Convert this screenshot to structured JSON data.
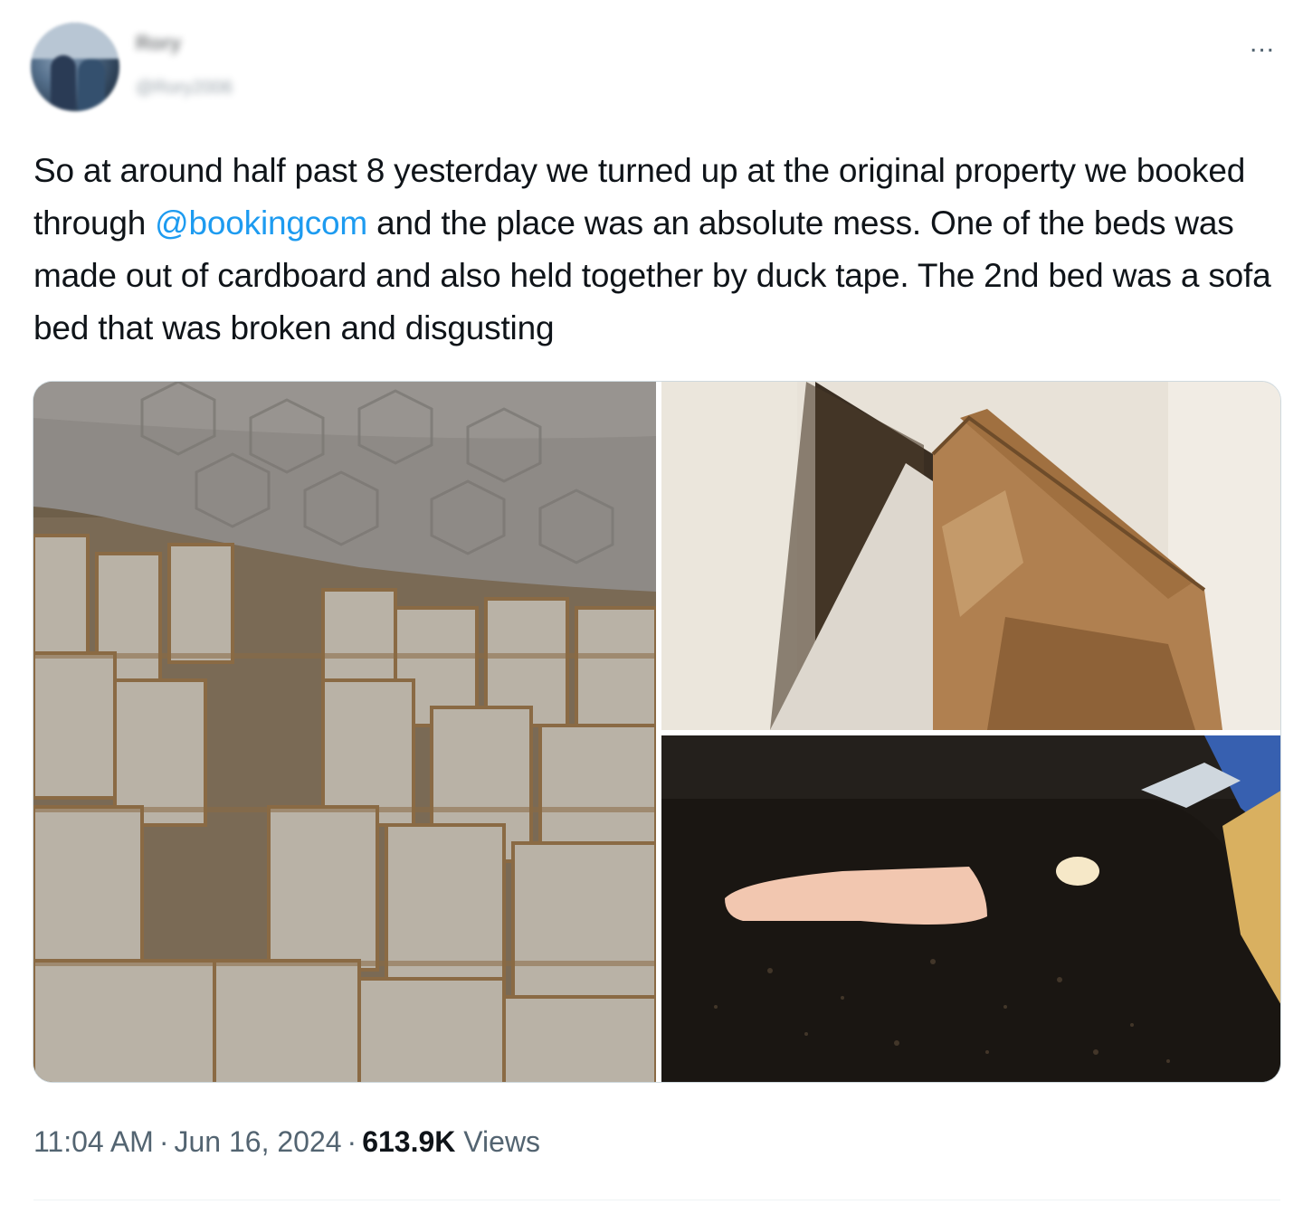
{
  "author": {
    "name": "Rory",
    "handle": "@Rory2006"
  },
  "menu": {
    "more_label": "..."
  },
  "tweet": {
    "text_before_mention": "So at around half past 8 yesterday we turned up at the original property we booked through ",
    "mention": "@bookingcom",
    "text_after_mention": " and the place was an absolute mess. One of the beds was made out of cardboard and also held together by duck tape. The 2nd bed was a sofa bed that was broken and disgusting"
  },
  "meta": {
    "time": "11:04 AM",
    "separator": "·",
    "date": "Jun 16, 2024",
    "views_count": "613.9K",
    "views_label": "Views"
  },
  "colors": {
    "link": "#1d9bf0",
    "text": "#0f1419",
    "secondary": "#536471"
  }
}
